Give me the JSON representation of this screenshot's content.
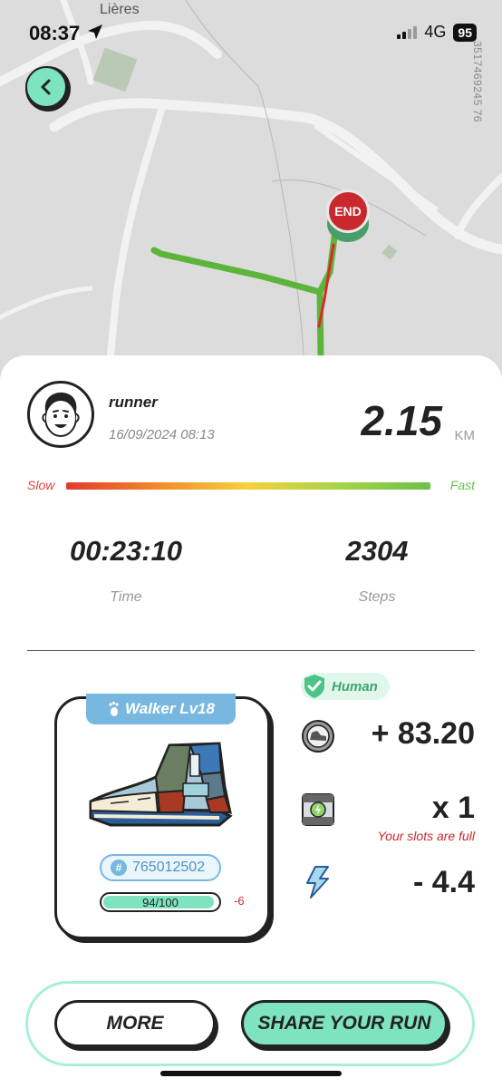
{
  "status": {
    "time": "08:37",
    "network": "4G",
    "battery": "95"
  },
  "map": {
    "place_label": "Lières",
    "map_id": "3517469245 76",
    "end_label": "END"
  },
  "user": {
    "name": "runner",
    "date": "16/09/2024 08:13"
  },
  "run": {
    "distance": "2.15",
    "distance_unit": "KM",
    "pace_slow": "Slow",
    "pace_fast": "Fast",
    "time": "00:23:10",
    "time_label": "Time",
    "steps": "2304",
    "steps_label": "Steps"
  },
  "shoe": {
    "tag": "Walker Lv18",
    "id": "765012502",
    "durability": "94/100",
    "durability_fraction": 0.94,
    "durability_delta": "-6"
  },
  "rewards": {
    "human_label": "Human",
    "earnings": "+ 83.20",
    "mystery_box": "x 1",
    "slots_full": "Your slots are full",
    "energy": "- 4.4"
  },
  "actions": {
    "more": "MORE",
    "share": "SHARE YOUR RUN"
  },
  "colors": {
    "accent": "#7de4bf",
    "end_red": "#c9282e",
    "shoe_blue": "#78b8e0",
    "route_green": "#5cb53a"
  }
}
